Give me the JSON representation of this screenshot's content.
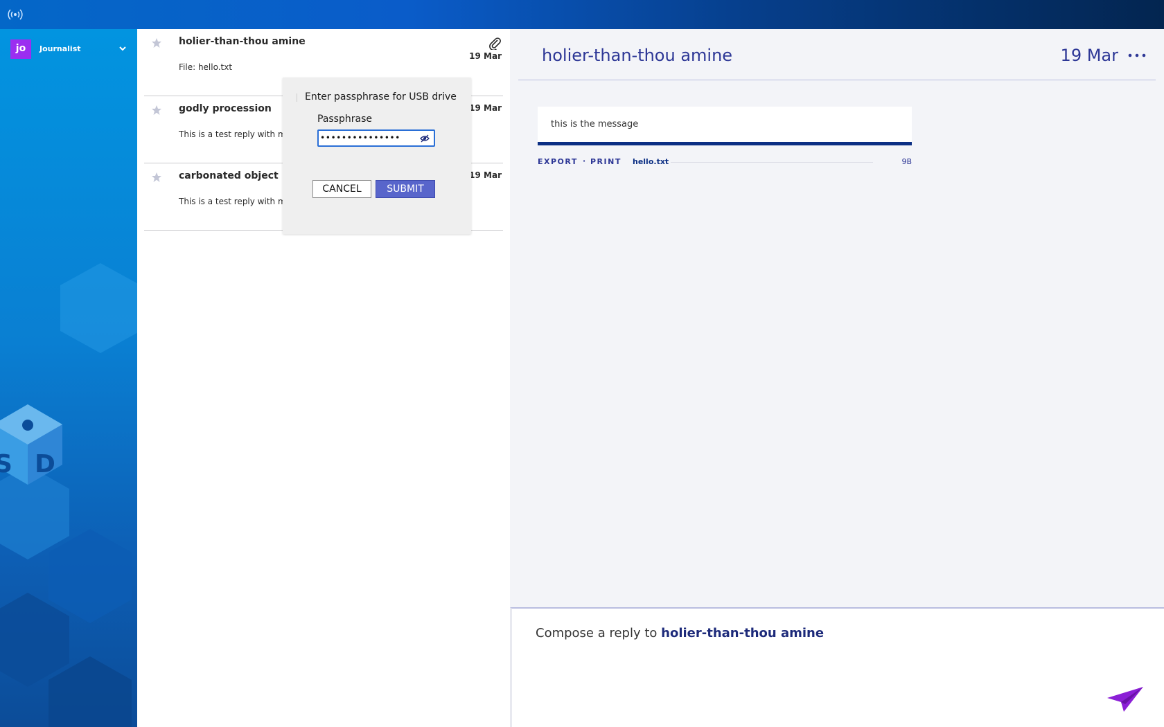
{
  "topbar": {
    "sync_icon": "broadcast-icon"
  },
  "user": {
    "initials": "jo",
    "name": "Journalist",
    "avatar_color": "#9b2ef0"
  },
  "sources": [
    {
      "name": "holier-than-thou amine",
      "preview": "File: hello.txt",
      "date": "19 Mar",
      "has_attachment": true
    },
    {
      "name": "godly procession",
      "preview": "This is a test reply with marku",
      "date": "19 Mar",
      "has_attachment": false
    },
    {
      "name": "carbonated object",
      "preview": "This is a test reply with marku",
      "date": "19 Mar",
      "has_attachment": false
    }
  ],
  "dialog": {
    "title": "Enter passphrase for USB drive",
    "label": "Passphrase",
    "masked_value": "•••••••••••••••",
    "cancel": "CANCEL",
    "submit": "SUBMIT"
  },
  "conversation": {
    "title": "holier-than-thou amine",
    "date": "19 Mar",
    "message": "this is the message",
    "file": {
      "export": "EXPORT",
      "separator": "·",
      "print": "PRINT",
      "name": "hello.txt",
      "size": "9B"
    }
  },
  "compose": {
    "prefix": "Compose a reply to ",
    "recipient": "holier-than-thou amine"
  },
  "colors": {
    "accent": "#2d3796",
    "submit": "#5865cb",
    "send": "#8b1fd6"
  }
}
